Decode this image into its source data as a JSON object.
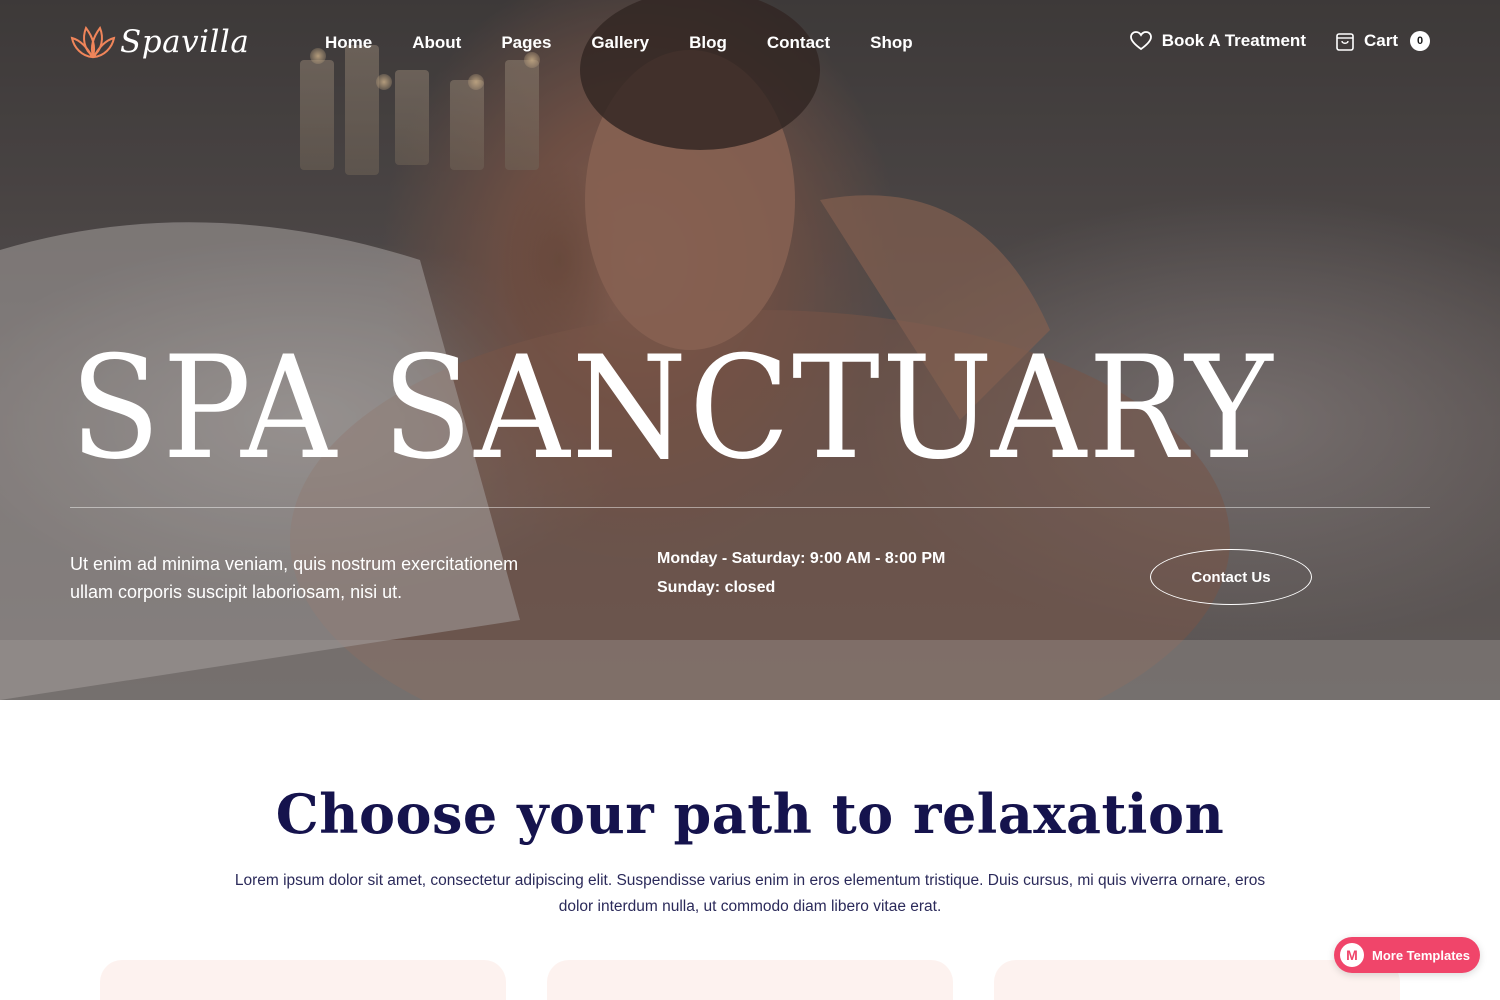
{
  "brand": {
    "name": "Spavilla",
    "accent": "#f0855a"
  },
  "nav": {
    "items": [
      {
        "label": "Home"
      },
      {
        "label": "About"
      },
      {
        "label": "Pages"
      },
      {
        "label": "Gallery"
      },
      {
        "label": "Blog"
      },
      {
        "label": "Contact"
      },
      {
        "label": "Shop"
      }
    ],
    "book_label": "Book A Treatment",
    "book_icon": "heart-icon",
    "cart_label": "Cart",
    "cart_icon": "bag-icon",
    "cart_count": "0"
  },
  "hero": {
    "title": "SPA SANCTUARY",
    "description": "Ut enim ad minima veniam, quis nostrum exercitationem ullam corporis suscipit laboriosam, nisi ut.",
    "hours_weekdays": "Monday - Saturday: 9:00 AM - 8:00 PM",
    "hours_sunday": "Sunday: closed",
    "cta_label": "Contact Us"
  },
  "section": {
    "title": "Choose your path to relaxation",
    "text": "Lorem ipsum dolor sit amet, consectetur adipiscing elit. Suspendisse varius enim in eros elementum tristique. Duis cursus, mi quis viverra ornare, eros dolor interdum nulla, ut commodo diam libero vitae erat."
  },
  "floating": {
    "label": "More Templates",
    "icon_letter": "M",
    "color": "#f0456a"
  },
  "colors": {
    "navy": "#15134d",
    "card_bg": "#fdf2ef"
  }
}
